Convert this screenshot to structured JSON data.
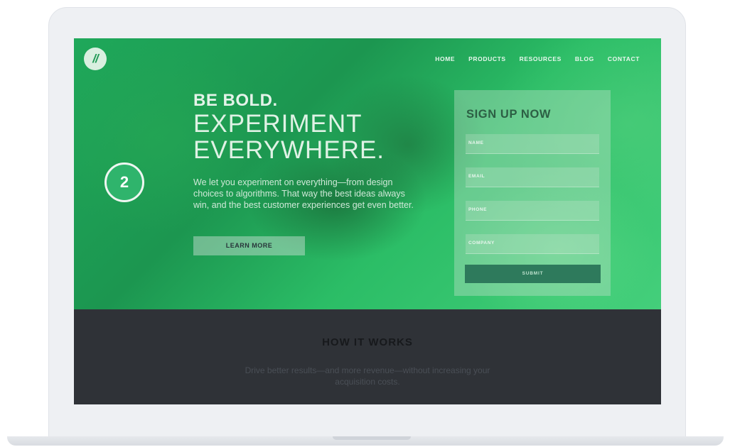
{
  "nav": {
    "items": [
      {
        "label": "HOME"
      },
      {
        "label": "PRODUCTS"
      },
      {
        "label": "RESOURCES"
      },
      {
        "label": "BLOG"
      },
      {
        "label": "CONTACT"
      }
    ]
  },
  "logo": {
    "text": "//"
  },
  "hero": {
    "headline_bold": "BE BOLD.",
    "headline_line1": "EXPERIMENT",
    "headline_line2": "EVERYWHERE.",
    "body": "We let you experiment on everything—from design choices to algorithms. That way the best ideas always win, and the best customer experiences get even better.",
    "cta_label": "LEARN MORE"
  },
  "step_badge": "2",
  "signup": {
    "title": "SIGN UP NOW",
    "fields": [
      {
        "placeholder": "NAME"
      },
      {
        "placeholder": "EMAIL"
      },
      {
        "placeholder": "PHONE"
      },
      {
        "placeholder": "COMPANY"
      }
    ],
    "submit_label": "SUBMIT"
  },
  "how_it_works": {
    "title": "HOW IT WORKS",
    "body": "Drive better results—and more revenue—without increasing your acquisition costs."
  },
  "colors": {
    "hero_green": "#1fa85a",
    "submit_button": "#2e7a5c",
    "dark_section": "#2f3237"
  }
}
